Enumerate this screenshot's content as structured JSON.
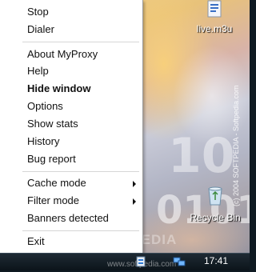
{
  "menu": {
    "items": [
      {
        "label": "Stop"
      },
      {
        "label": "Dialer"
      },
      {
        "label": "About MyProxy"
      },
      {
        "label": "Help"
      },
      {
        "label": "Hide window",
        "bold": true
      },
      {
        "label": "Options"
      },
      {
        "label": "Show stats"
      },
      {
        "label": "History"
      },
      {
        "label": "Bug report"
      },
      {
        "label": "Cache mode",
        "submenu": true
      },
      {
        "label": "Filter mode",
        "submenu": true
      },
      {
        "label": "Banners detected"
      },
      {
        "label": "Exit"
      }
    ]
  },
  "desktop": {
    "icons": [
      {
        "label": "live.m3u",
        "icon": "playlist-file-icon"
      },
      {
        "label": "Recycle Bin",
        "icon": "recycle-bin-icon"
      }
    ],
    "copyright": "(c) 2004 SOFTPEDIA - Softpedia.com",
    "watermark": "SOFTPEDIA"
  },
  "taskbar": {
    "url": "www.softpedia.com",
    "clock": "17:41",
    "tray_icons": [
      "myproxy-tray-icon",
      "network-tray-icon"
    ]
  },
  "colors": {
    "menu_bg": "#ffffff",
    "menu_text": "#111111",
    "taskbar_bg": "#0c141a"
  }
}
